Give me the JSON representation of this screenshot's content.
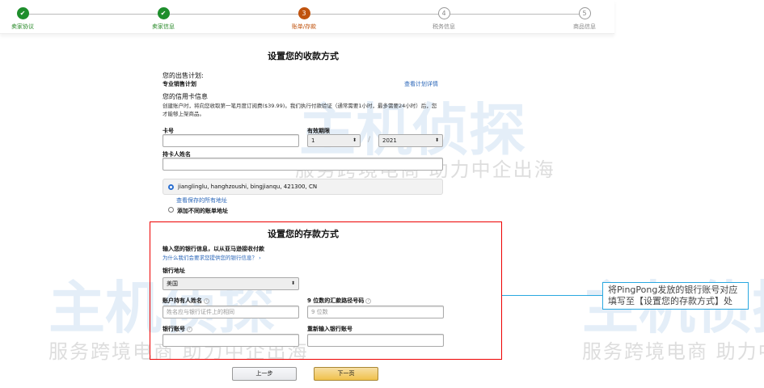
{
  "watermark": {
    "brand": "主机侦探",
    "slogan": "服务跨境电商 助力中企出海"
  },
  "steps": [
    {
      "num": "✔",
      "label": "卖家协议",
      "state": "done"
    },
    {
      "num": "✔",
      "label": "卖家信息",
      "state": "done"
    },
    {
      "num": "3",
      "label": "账单/存款",
      "state": "current"
    },
    {
      "num": "4",
      "label": "税务信息",
      "state": "todo"
    },
    {
      "num": "5",
      "label": "商品信息",
      "state": "todo"
    }
  ],
  "payment": {
    "title": "设置您的收款方式",
    "plan_label": "您的出售计划:",
    "plan_value": "专业销售计划",
    "plan_link": "查看计划详情",
    "card_heading": "您的信用卡信息",
    "card_desc1": "创建账户时，将向您收取第一笔月度订阅费($39.99)。我们执行付款验证（通常需要1小时，最多需要24小时）后，您",
    "card_desc2": "才能够上架商品。",
    "card_no_label": "卡号",
    "expiry_label": "有效期限",
    "expiry_month": "1",
    "expiry_year": "2021",
    "slash": "/",
    "holder_label": "持卡人姓名",
    "address": "jianglinglu, hanghzoushi, bingjianqu, 421300, CN",
    "view_addresses": "查看保存的所有地址",
    "add_address": "添加不同的账单地址"
  },
  "deposit": {
    "title": "设置您的存款方式",
    "intro": "输入您的银行信息，以从亚马逊接收付款",
    "why_link": "为什么我们会要求您提供您的银行信息？ ›",
    "bank_location_label": "银行地址",
    "bank_location_value": "美国",
    "holder_label": "账户持有人姓名",
    "holder_placeholder": "姓名应与银行证件上的相同",
    "routing_label": "9 位数的汇款路径号码",
    "routing_placeholder": "9 位数",
    "account_label": "银行账号",
    "reenter_label": "重新输入银行账号",
    "help": "?"
  },
  "buttons": {
    "back": "上一步",
    "next": "下一页"
  },
  "callout": {
    "line1": "将PingPong发放的银行账号对应",
    "line2": "填写至【设置您的存款方式】处"
  }
}
